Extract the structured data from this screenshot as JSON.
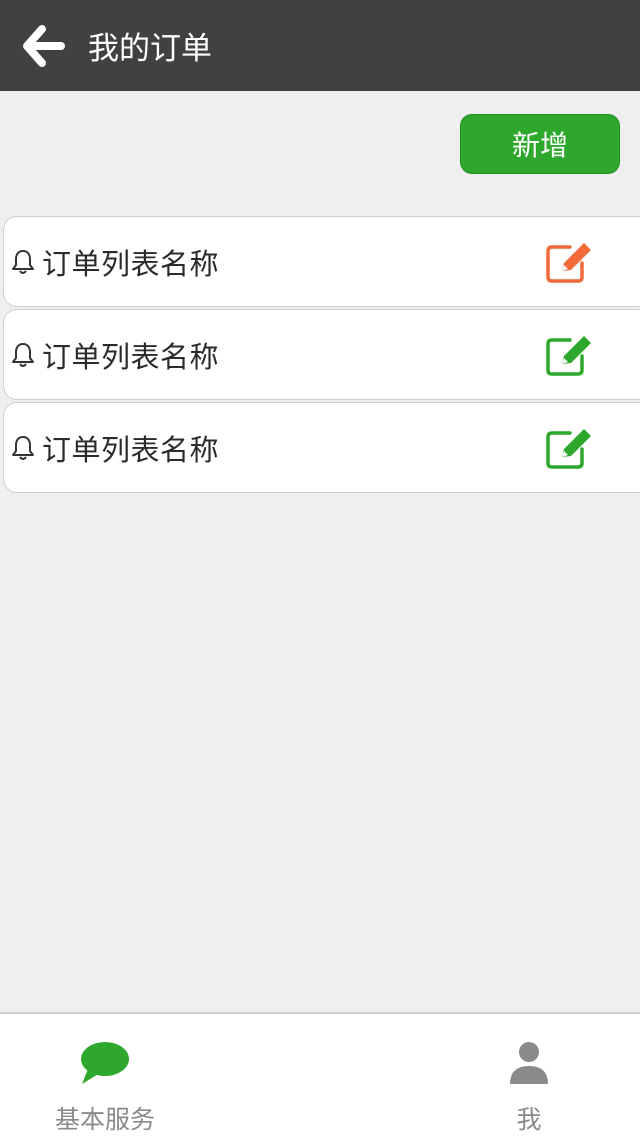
{
  "header": {
    "title": "我的订单",
    "back_icon": "arrow-left-icon"
  },
  "toolbar": {
    "add_label": "新增",
    "add_color": "#2ea82c"
  },
  "orders": [
    {
      "label": "订单列表名称",
      "icon": "bell-icon",
      "edit_icon": "edit-icon",
      "edit_color": "#f26a3a"
    },
    {
      "label": "订单列表名称",
      "icon": "bell-icon",
      "edit_icon": "edit-icon",
      "edit_color": "#2ea82c"
    },
    {
      "label": "订单列表名称",
      "icon": "bell-icon",
      "edit_icon": "edit-icon",
      "edit_color": "#2ea82c"
    }
  ],
  "tabbar": {
    "items": [
      {
        "label": "基本服务",
        "icon": "chat-bubble-icon",
        "color": "#2ea82c"
      },
      {
        "label": "我",
        "icon": "user-icon",
        "color": "#8a8a8a"
      }
    ]
  }
}
